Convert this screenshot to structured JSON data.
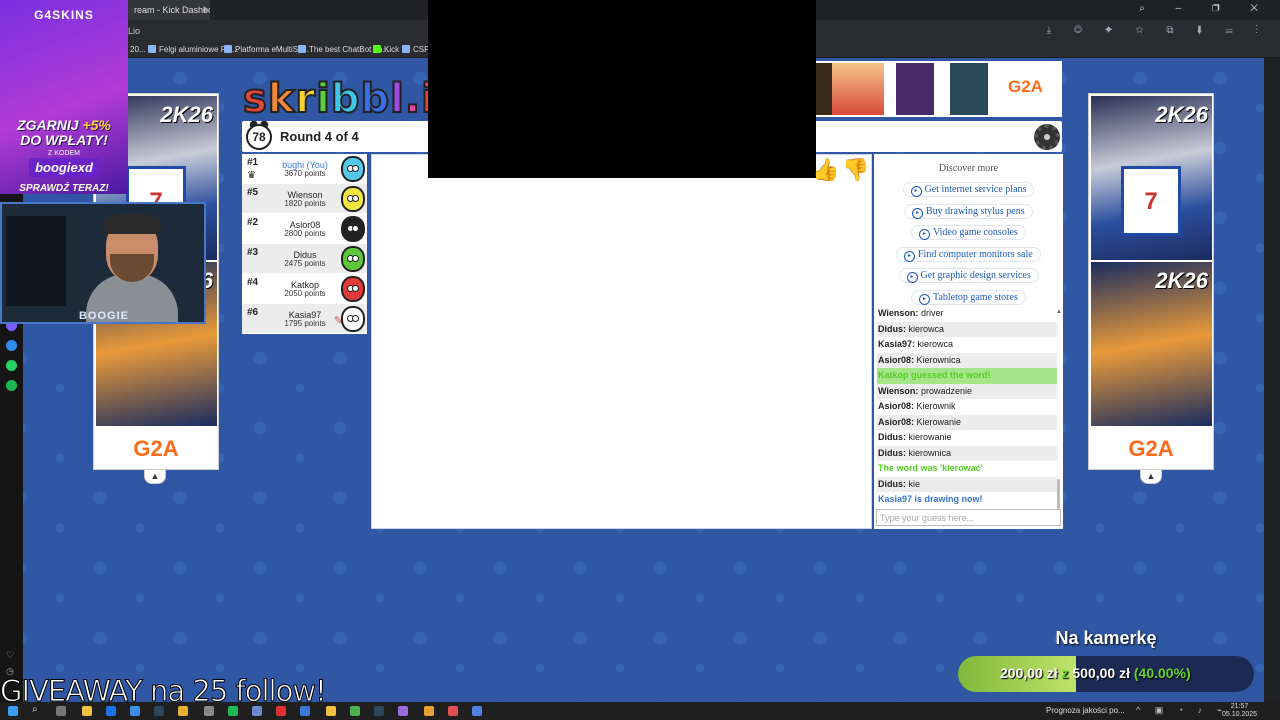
{
  "browser": {
    "tab_title": "ream - Kick Dashboard",
    "url": "Lio",
    "bookmarks": [
      "20...",
      "Felgi aluminiowe RE...",
      "Platforma eMultiSp...",
      "The best ChatBot an...",
      "Kick",
      "CSFlo"
    ]
  },
  "promo": {
    "brand": "G4SKINS",
    "line1": "ZGARNIJ",
    "percent": "+5%",
    "line2": "DO WPŁATY!",
    "with_code": "Z KODEM",
    "code": "boogiexd",
    "cta": "SPRAWDŹ TERAZ!"
  },
  "webcam": {
    "name": "BOOGIE"
  },
  "ads": {
    "left_title": "2K26",
    "right_title": "2K26",
    "jersey": "7",
    "brand": "G2A"
  },
  "game": {
    "logo": "skribbl.io",
    "timer": "78",
    "round": "Round 4 of 4",
    "players": [
      {
        "rank": "#1",
        "name": "bughi (You)",
        "points": "3670 points",
        "you": true,
        "avatar_color": "#55c8ee",
        "crown": true,
        "pencil": false
      },
      {
        "rank": "#5",
        "name": "Wienson",
        "points": "1820 points",
        "you": false,
        "avatar_color": "#f1e640",
        "crown": false,
        "pencil": false
      },
      {
        "rank": "#2",
        "name": "Asior08",
        "points": "2800 points",
        "you": false,
        "avatar_color": "#222222",
        "crown": false,
        "pencil": false
      },
      {
        "rank": "#3",
        "name": "Didus",
        "points": "2475 points",
        "you": false,
        "avatar_color": "#5ec83a",
        "crown": false,
        "pencil": false
      },
      {
        "rank": "#4",
        "name": "Katkop",
        "points": "2050 points",
        "you": false,
        "avatar_color": "#e03a3a",
        "crown": false,
        "pencil": false
      },
      {
        "rank": "#6",
        "name": "Kasia97",
        "points": "1795 points",
        "you": false,
        "avatar_color": "#ffffff",
        "crown": false,
        "pencil": true
      }
    ]
  },
  "discover": {
    "title": "Discover more",
    "links": [
      "Get internet service plans",
      "Buy drawing stylus pens",
      "Video game consoles",
      "Find computer monitors sale",
      "Get graphic design services",
      "Tabletop game stores"
    ]
  },
  "chat": {
    "messages": [
      {
        "user": "Wienson:",
        "text": "driver",
        "kind": "normal"
      },
      {
        "user": "Didus:",
        "text": "kierowca",
        "kind": "normal"
      },
      {
        "user": "Kasia97:",
        "text": "kierowca",
        "kind": "normal"
      },
      {
        "user": "Asior08:",
        "text": "Kierownica",
        "kind": "normal"
      },
      {
        "user": "",
        "text": "Katkop guessed the word!",
        "kind": "guessed"
      },
      {
        "user": "Wienson:",
        "text": "prowadzenie",
        "kind": "normal"
      },
      {
        "user": "Asior08:",
        "text": "Kierownik",
        "kind": "normal"
      },
      {
        "user": "Asior08:",
        "text": "Kierowanie",
        "kind": "normal"
      },
      {
        "user": "Didus:",
        "text": "kierowanie",
        "kind": "normal"
      },
      {
        "user": "Didus:",
        "text": "kierownica",
        "kind": "normal"
      },
      {
        "user": "",
        "text": "The word was 'kierować'",
        "kind": "green"
      },
      {
        "user": "Didus:",
        "text": "kie",
        "kind": "normal"
      },
      {
        "user": "",
        "text": "Kasia97 is drawing now!",
        "kind": "blue"
      }
    ],
    "input_placeholder": "Type your guess here..."
  },
  "overlay": {
    "giveaway": "GIVEAWAY na 25 follow!",
    "goal_title": "Na kamerkę",
    "goal_current": "200,00 zł",
    "goal_of": "z",
    "goal_target": "500,00 zł",
    "goal_percent": "(40.00%)",
    "goal_fraction": 0.4
  },
  "taskbar": {
    "weather": "Prognoza jakości po...",
    "time": "21:57",
    "date": "05.10.2025"
  },
  "colors": {
    "page_bg": "#2f57a4",
    "logo_letters": [
      "#e8463a",
      "#f2883b",
      "#f5d130",
      "#59d13b",
      "#3fc6e8",
      "#3a6ee8",
      "#a04be0",
      "#e24aa6",
      "#e8463a",
      "#f2883b"
    ]
  }
}
